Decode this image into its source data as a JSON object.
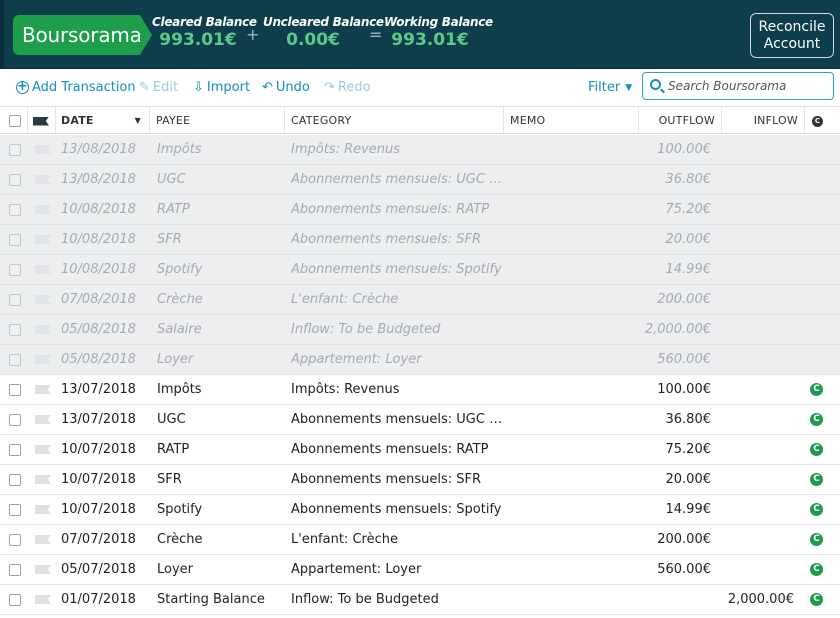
{
  "header": {
    "account_name": "Boursorama",
    "cleared": {
      "label": "Cleared Balance",
      "amount": "993.01€"
    },
    "plus": "+",
    "uncleared": {
      "label": "Uncleared Balance",
      "amount": "0.00€"
    },
    "equals": "=",
    "working": {
      "label": "Working Balance",
      "amount": "993.01€"
    },
    "reconcile_line1": "Reconcile",
    "reconcile_line2": "Account"
  },
  "toolbar": {
    "add_transaction": "Add Transaction",
    "edit": "Edit",
    "import": "Import",
    "undo": "Undo",
    "redo": "Redo",
    "filter": "Filter",
    "search_placeholder": "Search Boursorama"
  },
  "columns": {
    "date": "DATE",
    "payee": "PAYEE",
    "category": "CATEGORY",
    "memo": "MEMO",
    "outflow": "OUTFLOW",
    "inflow": "INFLOW"
  },
  "scheduled": [
    {
      "date": "13/08/2018",
      "payee": "Impôts",
      "category": "Impôts: Revenus",
      "outflow": "100.00€",
      "inflow": ""
    },
    {
      "date": "13/08/2018",
      "payee": "UGC",
      "category": "Abonnements mensuels: UGC Illimité",
      "outflow": "36.80€",
      "inflow": ""
    },
    {
      "date": "10/08/2018",
      "payee": "RATP",
      "category": "Abonnements mensuels: RATP",
      "outflow": "75.20€",
      "inflow": ""
    },
    {
      "date": "10/08/2018",
      "payee": "SFR",
      "category": "Abonnements mensuels: SFR",
      "outflow": "20.00€",
      "inflow": ""
    },
    {
      "date": "10/08/2018",
      "payee": "Spotify",
      "category": "Abonnements mensuels: Spotify",
      "outflow": "14.99€",
      "inflow": ""
    },
    {
      "date": "07/08/2018",
      "payee": "Crèche",
      "category": "L'enfant: Crèche",
      "outflow": "200.00€",
      "inflow": ""
    },
    {
      "date": "05/08/2018",
      "payee": "Salaire",
      "category": "Inflow: To be Budgeted",
      "outflow": "2,000.00€",
      "inflow": ""
    },
    {
      "date": "05/08/2018",
      "payee": "Loyer",
      "category": "Appartement: Loyer",
      "outflow": "560.00€",
      "inflow": ""
    }
  ],
  "transactions": [
    {
      "date": "13/07/2018",
      "payee": "Impôts",
      "category": "Impôts: Revenus",
      "outflow": "100.00€",
      "inflow": "",
      "cleared": "C"
    },
    {
      "date": "13/07/2018",
      "payee": "UGC",
      "category": "Abonnements mensuels: UGC Illimité",
      "outflow": "36.80€",
      "inflow": "",
      "cleared": "C"
    },
    {
      "date": "10/07/2018",
      "payee": "RATP",
      "category": "Abonnements mensuels: RATP",
      "outflow": "75.20€",
      "inflow": "",
      "cleared": "C"
    },
    {
      "date": "10/07/2018",
      "payee": "SFR",
      "category": "Abonnements mensuels: SFR",
      "outflow": "20.00€",
      "inflow": "",
      "cleared": "C"
    },
    {
      "date": "10/07/2018",
      "payee": "Spotify",
      "category": "Abonnements mensuels: Spotify",
      "outflow": "14.99€",
      "inflow": "",
      "cleared": "C"
    },
    {
      "date": "07/07/2018",
      "payee": "Crèche",
      "category": "L'enfant: Crèche",
      "outflow": "200.00€",
      "inflow": "",
      "cleared": "C"
    },
    {
      "date": "05/07/2018",
      "payee": "Loyer",
      "category": "Appartement: Loyer",
      "outflow": "560.00€",
      "inflow": "",
      "cleared": "C"
    },
    {
      "date": "01/07/2018",
      "payee": "Starting Balance",
      "category": "Inflow: To be Budgeted",
      "outflow": "",
      "inflow": "2,000.00€",
      "cleared": "C"
    }
  ],
  "icons": {
    "add": "plus-circle-icon",
    "edit": "pencil-icon",
    "import": "import-icon",
    "undo": "undo-icon",
    "redo": "redo-icon",
    "search": "search-icon",
    "flag": "flag-icon",
    "cleared": "cleared-icon"
  },
  "colors": {
    "header_bg": "#0e3d4b",
    "account_green": "#1d9e4b",
    "amount_green": "#5cc98a",
    "link_blue": "#148fb8",
    "cleared_green": "#1e9a4f"
  }
}
